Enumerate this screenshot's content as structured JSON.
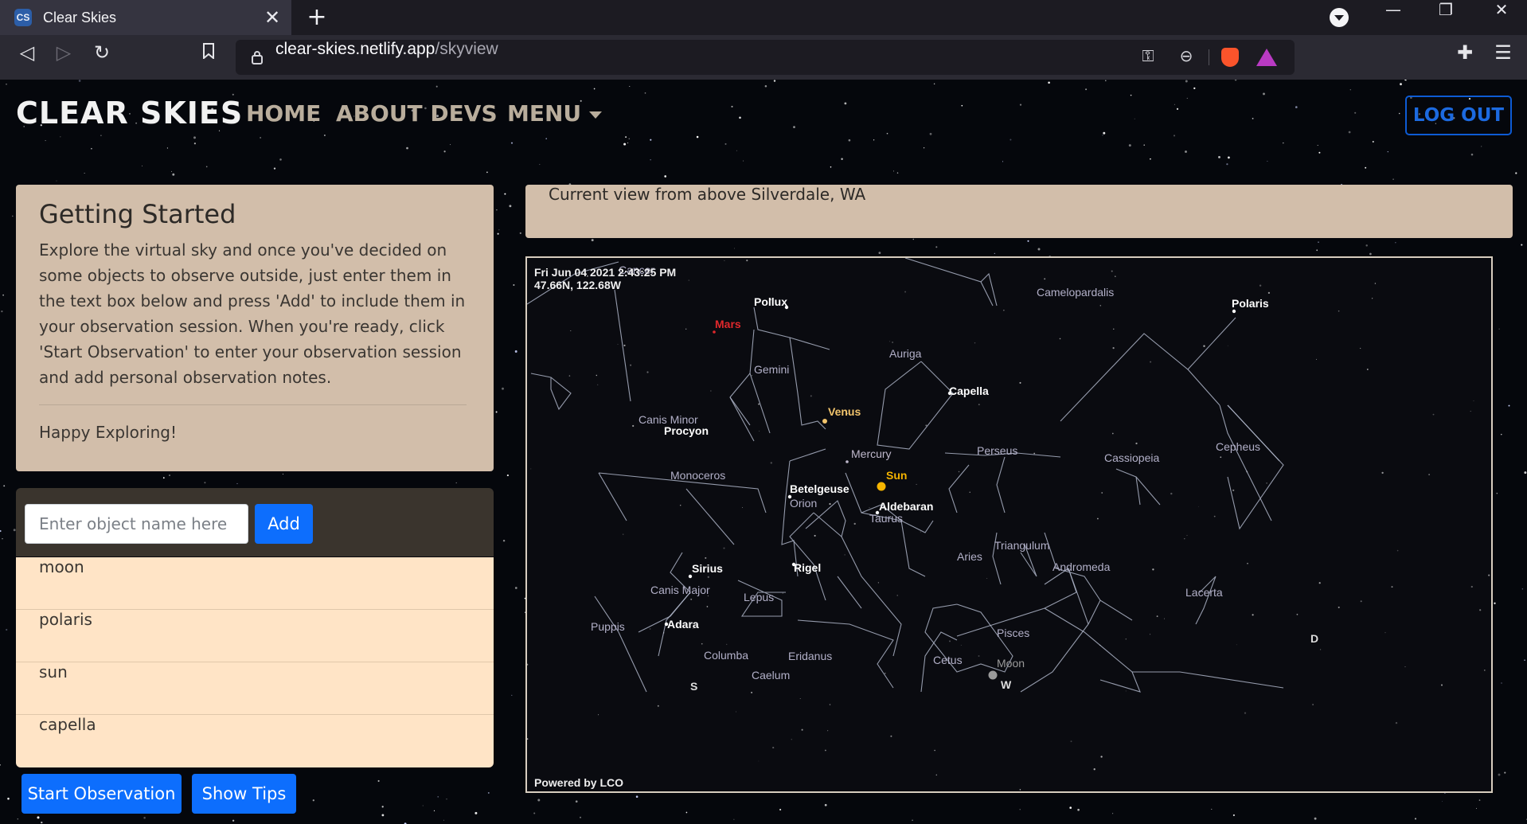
{
  "browser": {
    "tab_title": "Clear Skies",
    "tab_favicon": "CS",
    "url_domain": "clear-skies.netlify.app",
    "url_path": "/skyview"
  },
  "site": {
    "brand": "CLEAR SKIES",
    "nav": [
      "HOME",
      "ABOUT DEVS",
      "MENU"
    ],
    "logout": "LOG OUT"
  },
  "getting_started": {
    "title": "Getting Started",
    "body": "Explore the virtual sky and once you've decided on some objects to observe outside, just enter them in the text box below and press 'Add' to include them in your observation session. When you're ready, click 'Start Observation' to enter your observation session and add personal observation notes.",
    "footer": "Happy Exploring!"
  },
  "add_form": {
    "placeholder": "Enter object name here",
    "button": "Add"
  },
  "objects": [
    "moon",
    "polaris",
    "sun",
    "capella"
  ],
  "buttons": {
    "start": "Start Observation",
    "tips": "Show Tips"
  },
  "sky": {
    "location_banner": "Current view from above Silverdale, WA",
    "timestamp": "Fri Jun 04 2021 2:43:25 PM",
    "coords": "47.66N, 122.68W",
    "credit": "Powered by LCO",
    "constellations": [
      "Cancer",
      "Camelopardalis",
      "Gemini",
      "Auriga",
      "Canis Minor",
      "Perseus",
      "Cassiopeia",
      "Cepheus",
      "Monoceros",
      "Orion",
      "Taurus",
      "Triangulum",
      "Aries",
      "Andromeda",
      "Canis Major",
      "Lepus",
      "Lacerta",
      "Puppis",
      "Pisces",
      "Columba",
      "Eridanus",
      "Cetus",
      "Caelum"
    ],
    "stars": [
      "Pollux",
      "Polaris",
      "Capella",
      "Procyon",
      "Betelgeuse",
      "Aldebaran",
      "Sirius",
      "Rigel",
      "Adara"
    ],
    "bodies": [
      {
        "name": "Mars",
        "color": "#e0282c"
      },
      {
        "name": "Venus",
        "color": "#f2c46c"
      },
      {
        "name": "Mercury",
        "color": "#bfb8cc"
      },
      {
        "name": "Sun",
        "color": "#f5b400"
      },
      {
        "name": "Moon",
        "color": "#9a9a9a"
      }
    ],
    "compass": [
      "S",
      "W",
      "D"
    ]
  },
  "colors": {
    "accent": "#0d6efd",
    "card": "#d2beaa",
    "list": "#ffe4c6",
    "nav_text": "#b9ad9c"
  }
}
